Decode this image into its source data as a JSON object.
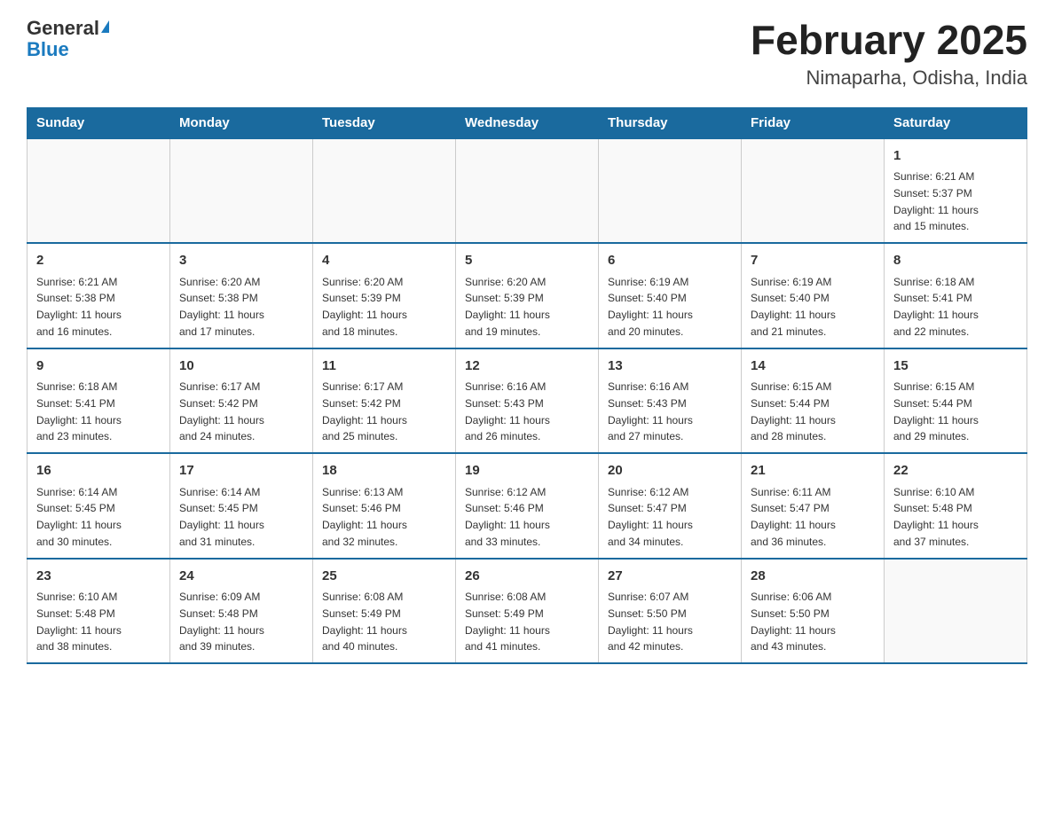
{
  "logo": {
    "general": "General",
    "blue": "Blue",
    "triangle": "▲"
  },
  "title": {
    "month": "February 2025",
    "location": "Nimaparha, Odisha, India"
  },
  "headers": [
    "Sunday",
    "Monday",
    "Tuesday",
    "Wednesday",
    "Thursday",
    "Friday",
    "Saturday"
  ],
  "weeks": [
    [
      {
        "day": "",
        "info": ""
      },
      {
        "day": "",
        "info": ""
      },
      {
        "day": "",
        "info": ""
      },
      {
        "day": "",
        "info": ""
      },
      {
        "day": "",
        "info": ""
      },
      {
        "day": "",
        "info": ""
      },
      {
        "day": "1",
        "info": "Sunrise: 6:21 AM\nSunset: 5:37 PM\nDaylight: 11 hours\nand 15 minutes."
      }
    ],
    [
      {
        "day": "2",
        "info": "Sunrise: 6:21 AM\nSunset: 5:38 PM\nDaylight: 11 hours\nand 16 minutes."
      },
      {
        "day": "3",
        "info": "Sunrise: 6:20 AM\nSunset: 5:38 PM\nDaylight: 11 hours\nand 17 minutes."
      },
      {
        "day": "4",
        "info": "Sunrise: 6:20 AM\nSunset: 5:39 PM\nDaylight: 11 hours\nand 18 minutes."
      },
      {
        "day": "5",
        "info": "Sunrise: 6:20 AM\nSunset: 5:39 PM\nDaylight: 11 hours\nand 19 minutes."
      },
      {
        "day": "6",
        "info": "Sunrise: 6:19 AM\nSunset: 5:40 PM\nDaylight: 11 hours\nand 20 minutes."
      },
      {
        "day": "7",
        "info": "Sunrise: 6:19 AM\nSunset: 5:40 PM\nDaylight: 11 hours\nand 21 minutes."
      },
      {
        "day": "8",
        "info": "Sunrise: 6:18 AM\nSunset: 5:41 PM\nDaylight: 11 hours\nand 22 minutes."
      }
    ],
    [
      {
        "day": "9",
        "info": "Sunrise: 6:18 AM\nSunset: 5:41 PM\nDaylight: 11 hours\nand 23 minutes."
      },
      {
        "day": "10",
        "info": "Sunrise: 6:17 AM\nSunset: 5:42 PM\nDaylight: 11 hours\nand 24 minutes."
      },
      {
        "day": "11",
        "info": "Sunrise: 6:17 AM\nSunset: 5:42 PM\nDaylight: 11 hours\nand 25 minutes."
      },
      {
        "day": "12",
        "info": "Sunrise: 6:16 AM\nSunset: 5:43 PM\nDaylight: 11 hours\nand 26 minutes."
      },
      {
        "day": "13",
        "info": "Sunrise: 6:16 AM\nSunset: 5:43 PM\nDaylight: 11 hours\nand 27 minutes."
      },
      {
        "day": "14",
        "info": "Sunrise: 6:15 AM\nSunset: 5:44 PM\nDaylight: 11 hours\nand 28 minutes."
      },
      {
        "day": "15",
        "info": "Sunrise: 6:15 AM\nSunset: 5:44 PM\nDaylight: 11 hours\nand 29 minutes."
      }
    ],
    [
      {
        "day": "16",
        "info": "Sunrise: 6:14 AM\nSunset: 5:45 PM\nDaylight: 11 hours\nand 30 minutes."
      },
      {
        "day": "17",
        "info": "Sunrise: 6:14 AM\nSunset: 5:45 PM\nDaylight: 11 hours\nand 31 minutes."
      },
      {
        "day": "18",
        "info": "Sunrise: 6:13 AM\nSunset: 5:46 PM\nDaylight: 11 hours\nand 32 minutes."
      },
      {
        "day": "19",
        "info": "Sunrise: 6:12 AM\nSunset: 5:46 PM\nDaylight: 11 hours\nand 33 minutes."
      },
      {
        "day": "20",
        "info": "Sunrise: 6:12 AM\nSunset: 5:47 PM\nDaylight: 11 hours\nand 34 minutes."
      },
      {
        "day": "21",
        "info": "Sunrise: 6:11 AM\nSunset: 5:47 PM\nDaylight: 11 hours\nand 36 minutes."
      },
      {
        "day": "22",
        "info": "Sunrise: 6:10 AM\nSunset: 5:48 PM\nDaylight: 11 hours\nand 37 minutes."
      }
    ],
    [
      {
        "day": "23",
        "info": "Sunrise: 6:10 AM\nSunset: 5:48 PM\nDaylight: 11 hours\nand 38 minutes."
      },
      {
        "day": "24",
        "info": "Sunrise: 6:09 AM\nSunset: 5:48 PM\nDaylight: 11 hours\nand 39 minutes."
      },
      {
        "day": "25",
        "info": "Sunrise: 6:08 AM\nSunset: 5:49 PM\nDaylight: 11 hours\nand 40 minutes."
      },
      {
        "day": "26",
        "info": "Sunrise: 6:08 AM\nSunset: 5:49 PM\nDaylight: 11 hours\nand 41 minutes."
      },
      {
        "day": "27",
        "info": "Sunrise: 6:07 AM\nSunset: 5:50 PM\nDaylight: 11 hours\nand 42 minutes."
      },
      {
        "day": "28",
        "info": "Sunrise: 6:06 AM\nSunset: 5:50 PM\nDaylight: 11 hours\nand 43 minutes."
      },
      {
        "day": "",
        "info": ""
      }
    ]
  ]
}
